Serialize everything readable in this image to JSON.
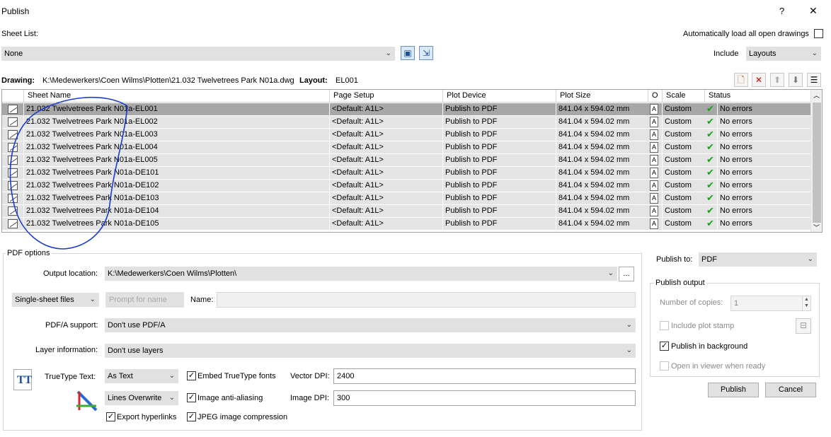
{
  "window": {
    "title": "Publish",
    "help": "?",
    "close": "✕"
  },
  "sheet_list": {
    "label": "Sheet List:",
    "value": "None",
    "auto_load_label": "Automatically load all open drawings",
    "auto_load_checked": false,
    "include_label": "Include",
    "include_value": "Layouts"
  },
  "drawing": {
    "drawing_label": "Drawing:",
    "drawing_path": "K:\\Medewerkers\\Coen Wilms\\Plotten\\21.032 Twelvetrees Park N01a.dwg",
    "layout_label": "Layout:",
    "layout_value": "EL001"
  },
  "table": {
    "columns": [
      "Sheet Name",
      "Page Setup",
      "Plot Device",
      "Plot Size",
      "O",
      "Scale",
      "Status"
    ],
    "rows": [
      {
        "name": "21.032 Twelvetrees Park N01a-EL001",
        "setup": "<Default: A1L>",
        "device": "Publish to PDF",
        "size": "841.04 x 594.02 mm",
        "orient": "A",
        "scale": "Custom",
        "status": "No errors"
      },
      {
        "name": "21.032 Twelvetrees Park N01a-EL002",
        "setup": "<Default: A1L>",
        "device": "Publish to PDF",
        "size": "841.04 x 594.02 mm",
        "orient": "A",
        "scale": "Custom",
        "status": "No errors"
      },
      {
        "name": "21.032 Twelvetrees Park N01a-EL003",
        "setup": "<Default: A1L>",
        "device": "Publish to PDF",
        "size": "841.04 x 594.02 mm",
        "orient": "A",
        "scale": "Custom",
        "status": "No errors"
      },
      {
        "name": "21.032 Twelvetrees Park N01a-EL004",
        "setup": "<Default: A1L>",
        "device": "Publish to PDF",
        "size": "841.04 x 594.02 mm",
        "orient": "A",
        "scale": "Custom",
        "status": "No errors"
      },
      {
        "name": "21.032 Twelvetrees Park N01a-EL005",
        "setup": "<Default: A1L>",
        "device": "Publish to PDF",
        "size": "841.04 x 594.02 mm",
        "orient": "A",
        "scale": "Custom",
        "status": "No errors"
      },
      {
        "name": "21.032 Twelvetrees Park N01a-DE101",
        "setup": "<Default: A1L>",
        "device": "Publish to PDF",
        "size": "841.04 x 594.02 mm",
        "orient": "A",
        "scale": "Custom",
        "status": "No errors"
      },
      {
        "name": "21.032 Twelvetrees Park N01a-DE102",
        "setup": "<Default: A1L>",
        "device": "Publish to PDF",
        "size": "841.04 x 594.02 mm",
        "orient": "A",
        "scale": "Custom",
        "status": "No errors"
      },
      {
        "name": "21.032 Twelvetrees Park N01a-DE103",
        "setup": "<Default: A1L>",
        "device": "Publish to PDF",
        "size": "841.04 x 594.02 mm",
        "orient": "A",
        "scale": "Custom",
        "status": "No errors"
      },
      {
        "name": "21.032 Twelvetrees Park N01a-DE104",
        "setup": "<Default: A1L>",
        "device": "Publish to PDF",
        "size": "841.04 x 594.02 mm",
        "orient": "A",
        "scale": "Custom",
        "status": "No errors"
      },
      {
        "name": "21.032 Twelvetrees Park N01a-DE105",
        "setup": "<Default: A1L>",
        "device": "Publish to PDF",
        "size": "841.04 x 594.02 mm",
        "orient": "A",
        "scale": "Custom",
        "status": "No errors"
      }
    ],
    "selected_row": 0
  },
  "pdf_options": {
    "title": "PDF options",
    "output_location_label": "Output location:",
    "output_location_value": "K:\\Medewerkers\\Coen Wilms\\Plotten\\",
    "browse_label": "...",
    "file_type_value": "Single-sheet files",
    "prompt_for_name_label": "Prompt for name",
    "name_label": "Name:",
    "pdfa_label": "PDF/A support:",
    "pdfa_value": "Don't use PDF/A",
    "layer_label": "Layer information:",
    "layer_value": "Don't use layers",
    "truetype_label": "TrueType Text:",
    "truetype_value": "As Text",
    "lines_value": "Lines Overwrite",
    "embed_fonts_label": "Embed TrueType fonts",
    "anti_alias_label": "Image anti-aliasing",
    "export_hyperlinks_label": "Export hyperlinks",
    "jpeg_label": "JPEG image compression",
    "vector_dpi_label": "Vector DPI:",
    "vector_dpi_value": "2400",
    "image_dpi_label": "Image DPI:",
    "image_dpi_value": "300"
  },
  "publish_to": {
    "label": "Publish to:",
    "value": "PDF"
  },
  "publish_output": {
    "title": "Publish output",
    "copies_label": "Number of copies:",
    "copies_value": "1",
    "plot_stamp_label": "Include plot stamp",
    "background_label": "Publish in background",
    "open_viewer_label": "Open in viewer when ready"
  },
  "buttons": {
    "publish": "Publish",
    "cancel": "Cancel"
  },
  "check_mark": "✓",
  "colors": {
    "selected_row": "#a7a7a7",
    "row": "#e4e4e4",
    "status_ok": "#17a317",
    "annotation": "#1a3ccf"
  }
}
